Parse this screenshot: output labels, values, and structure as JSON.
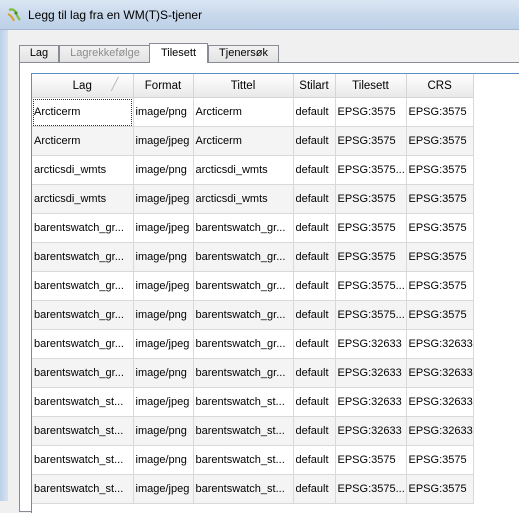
{
  "window": {
    "title": "Legg til lag fra en WM(T)S-tjener"
  },
  "icons": {
    "app": "qgis-icon",
    "sort": "sort-indicator-icon"
  },
  "tabs": [
    {
      "label": "Lag",
      "state": "normal"
    },
    {
      "label": "Lagrekkefølge",
      "state": "disabled"
    },
    {
      "label": "Tilesett",
      "state": "active"
    },
    {
      "label": "Tjenersøk",
      "state": "normal"
    }
  ],
  "table": {
    "columns": [
      "Lag",
      "Format",
      "Tittel",
      "Stilart",
      "Tilesett",
      "CRS"
    ],
    "rows": [
      [
        "Arcticerm",
        "image/png",
        "Arcticerm",
        "default",
        "EPSG:3575",
        "EPSG:3575"
      ],
      [
        "Arcticerm",
        "image/jpeg",
        "Arcticerm",
        "default",
        "EPSG:3575",
        "EPSG:3575"
      ],
      [
        "arcticsdi_wmts",
        "image/png",
        "arcticsdi_wmts",
        "default",
        "EPSG:3575...",
        "EPSG:3575"
      ],
      [
        "arcticsdi_wmts",
        "image/jpeg",
        "arcticsdi_wmts",
        "default",
        "EPSG:3575",
        "EPSG:3575"
      ],
      [
        "barentswatch_gr...",
        "image/jpeg",
        "barentswatch_gr...",
        "default",
        "EPSG:3575",
        "EPSG:3575"
      ],
      [
        "barentswatch_gr...",
        "image/png",
        "barentswatch_gr...",
        "default",
        "EPSG:3575",
        "EPSG:3575"
      ],
      [
        "barentswatch_gr...",
        "image/jpeg",
        "barentswatch_gr...",
        "default",
        "EPSG:3575...",
        "EPSG:3575"
      ],
      [
        "barentswatch_gr...",
        "image/png",
        "barentswatch_gr...",
        "default",
        "EPSG:3575...",
        "EPSG:3575"
      ],
      [
        "barentswatch_gr...",
        "image/jpeg",
        "barentswatch_gr...",
        "default",
        "EPSG:32633",
        "EPSG:32633"
      ],
      [
        "barentswatch_gr...",
        "image/png",
        "barentswatch_gr...",
        "default",
        "EPSG:32633",
        "EPSG:32633"
      ],
      [
        "barentswatch_st...",
        "image/jpeg",
        "barentswatch_st...",
        "default",
        "EPSG:32633",
        "EPSG:32633"
      ],
      [
        "barentswatch_st...",
        "image/png",
        "barentswatch_st...",
        "default",
        "EPSG:32633",
        "EPSG:32633"
      ],
      [
        "barentswatch_st...",
        "image/png",
        "barentswatch_st...",
        "default",
        "EPSG:3575",
        "EPSG:3575"
      ],
      [
        "barentswatch_st...",
        "image/jpeg",
        "barentswatch_st...",
        "default",
        "EPSG:3575...",
        "EPSG:3575"
      ]
    ]
  },
  "colors": {
    "selection_border": "#5a8fc8",
    "titlebar": "#c9d9ec"
  }
}
